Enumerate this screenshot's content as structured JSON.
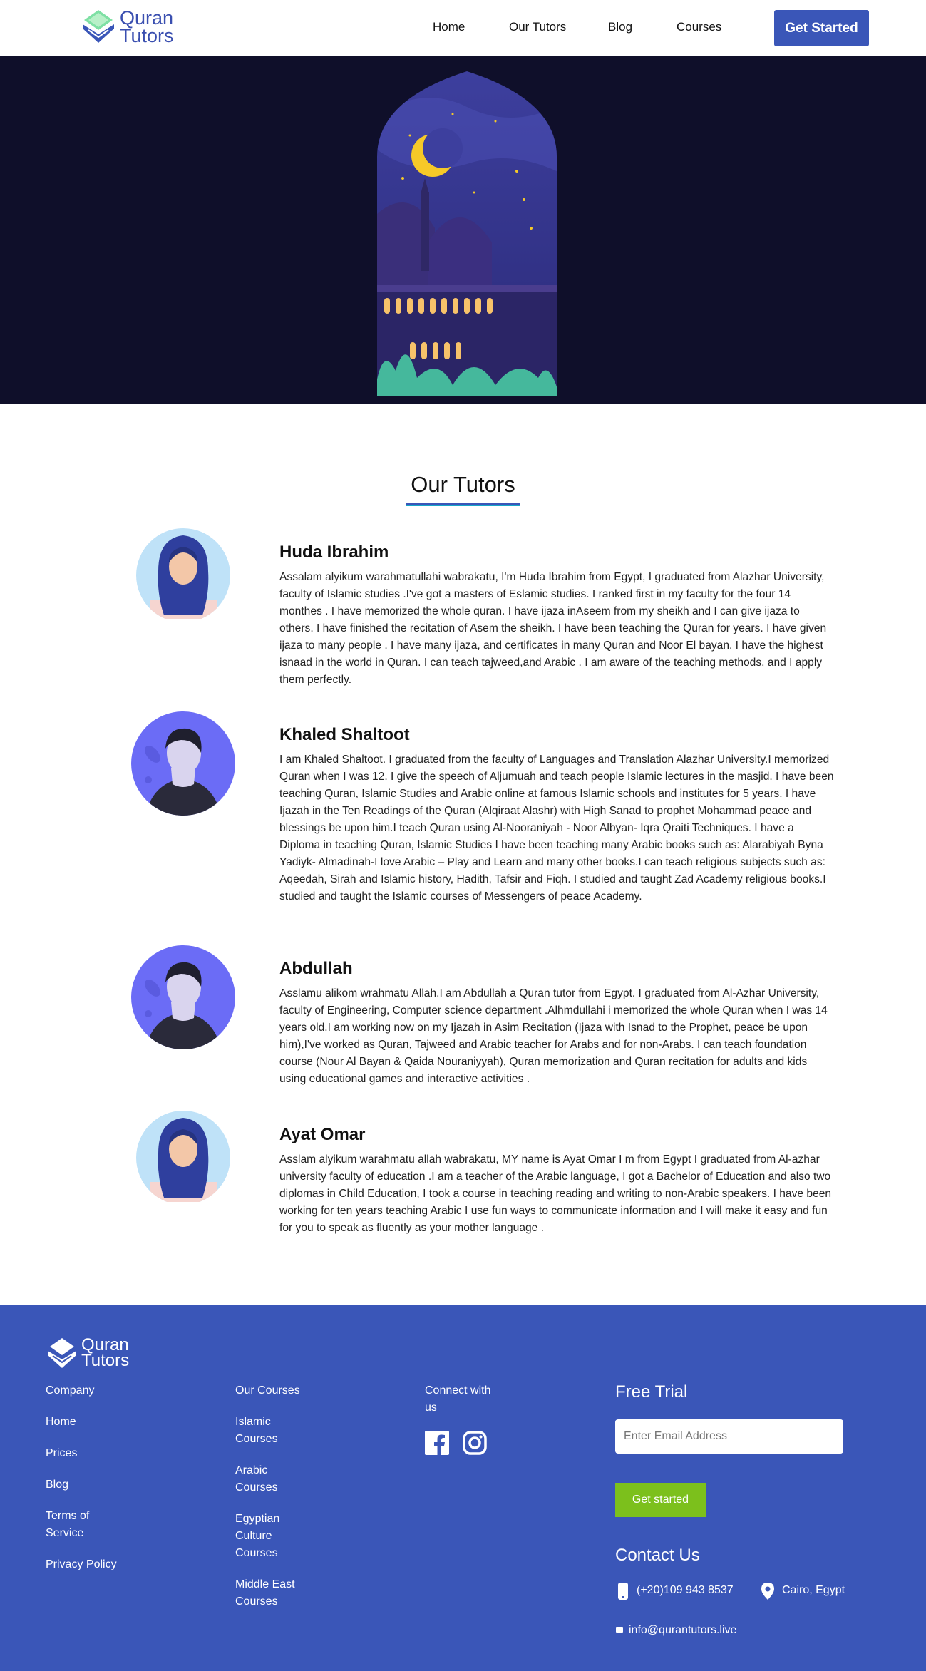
{
  "brand": {
    "logo_line1": "Quran",
    "logo_line2": "Tutors"
  },
  "nav": {
    "links": [
      "Home",
      "Our Tutors",
      "Blog",
      "Courses"
    ],
    "cta": "Get Started"
  },
  "tutors_section": {
    "title": "Our Tutors",
    "tutors": [
      {
        "name": "Huda Ibrahim",
        "avatar": "female-avatar",
        "bio": "Assalam alyikum warahmatullahi wabrakatu, I'm Huda Ibrahim from Egypt, I graduated from Alazhar University, faculty of Islamic studies .I've got a masters of Eslamic studies. I ranked first in my faculty for the four 14 monthes . I have memorized the whole quran. I have ijaza inAseem from my sheikh and I can give ijaza to others. I have finished the recitation of Asem the sheikh. I have been teaching the Quran for years. I have given ijaza to many people . I have many ijaza, and certificates in many Quran and Noor El bayan. I have the highest isnaad in the world in Quran. I can teach tajweed,and Arabic . I am aware of the teaching methods, and I apply them perfectly."
      },
      {
        "name": "Khaled Shaltoot",
        "avatar": "male-avatar",
        "bio": "I am Khaled Shaltoot. I graduated from the faculty of Languages and Translation Alazhar University.I memorized Quran when I was 12. I give the speech of Aljumuah and teach people Islamic lectures in the masjid. I have been teaching Quran, Islamic Studies and Arabic online at famous Islamic schools and institutes for 5 years. I have Ijazah in the Ten Readings of the Quran (Alqiraat Alashr) with High Sanad to prophet Mohammad peace and blessings be upon him.I teach Quran using Al-Nooraniyah - Noor Albyan- Iqra Qraiti Techniques. I have a Diploma in teaching Quran, Islamic Studies I have been teaching many Arabic books such as: Alarabiyah Byna Yadiyk- Almadinah-I love Arabic – Play and Learn and many other books.I can teach religious subjects such as: Aqeedah, Sirah and Islamic history, Hadith, Tafsir and Fiqh. I studied and taught Zad Academy religious books.I studied and taught the Islamic courses of Messengers of peace Academy."
      },
      {
        "name": "Abdullah",
        "avatar": "male-avatar",
        "bio": "Asslamu alikom wrahmatu Allah.I am Abdullah a Quran tutor from Egypt. I graduated from Al-Azhar University, faculty of Engineering, Computer science department .Alhmdullahi i memorized the whole Quran when I was 14 years old.I am working now on my Ijazah in Asim Recitation (Ijaza with Isnad to the Prophet, peace be upon him),I've worked as Quran, Tajweed and Arabic teacher for Arabs and for non-Arabs. I can teach foundation course (Nour Al Bayan & Qaida Nouraniyyah), Quran memorization and Quran recitation for adults and kids using educational games and interactive activities ."
      },
      {
        "name": "Ayat Omar",
        "avatar": "female-avatar",
        "bio": "Asslam alyikum warahmatu allah wabrakatu, MY name is Ayat Omar I m from Egypt I graduated from Al-azhar university faculty of education .I am a teacher of the Arabic language, I got a Bachelor of Education and also two diplomas in Child Education, I took a course in teaching reading and writing to non-Arabic speakers. I have been working for ten years teaching Arabic I use fun ways to communicate information and I will make it easy and fun for you to speak as fluently as your mother language ."
      }
    ]
  },
  "footer": {
    "col1": [
      "Company",
      "Home",
      "Prices",
      "Blog",
      "Terms of Service",
      "Privacy Policy"
    ],
    "col2_heading": "Our Courses",
    "col2": [
      "Islamic Courses",
      "Arabic Courses",
      "Egyptian Culture Courses",
      "Middle East Courses"
    ],
    "connect": "Connect with us",
    "social": [
      "facebook-icon",
      "instagram-icon"
    ],
    "free_trial": "Free Trial",
    "email_placeholder": "Enter Email Address",
    "trial_button": "Get started",
    "contact_title": "Contact Us",
    "phone": "(+20)109 943 8537",
    "location": "Cairo, Egypt",
    "email": "info@qurantutors.live"
  },
  "colors": {
    "brand": "#3a56b8",
    "hero_bg": "#0f0f2a",
    "cta_green": "#7cc01c"
  }
}
